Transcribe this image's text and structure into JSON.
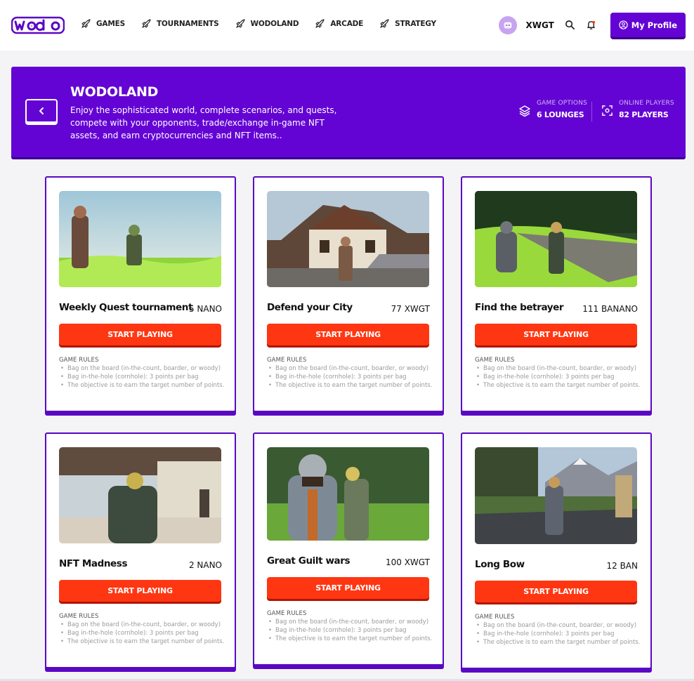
{
  "nav": {
    "logo_text": "wodo",
    "items": [
      {
        "label": "GAMES"
      },
      {
        "label": "TOURNAMENTS"
      },
      {
        "label": "WODOLAND"
      },
      {
        "label": "ARCADE"
      },
      {
        "label": "STRATEGY"
      }
    ],
    "username": "XWGT",
    "profile_label": "My Profile"
  },
  "banner": {
    "title": "WODOLAND",
    "description": "Enjoy the sophisticated world, complete scenarios, and quests, compete with your opponents, trade/exchange in-game NFT assets, and earn cryptocurrencies and NFT items..",
    "stats": [
      {
        "label": "GAME OPTIONS",
        "value": "6 LOUNGES"
      },
      {
        "label": "ONLINE PLAYERS",
        "value": "82 PLAYERS"
      }
    ]
  },
  "rules": {
    "heading": "GAME RULES",
    "items": [
      "Bag on the board (in-the-count, boarder, or woody)",
      "Bag in-the-hole (cornhole): 3 points per bag",
      "The objective is to earn the target number of points."
    ]
  },
  "cards": [
    {
      "title": "Weekly Quest tournament",
      "price": "5 NANO",
      "button": "START PLAYING"
    },
    {
      "title": "Defend your City",
      "price": "77 XWGT",
      "button": "START PLAYING"
    },
    {
      "title": "Find the betrayer",
      "price": "111 BANANO",
      "button": "START PLAYING"
    },
    {
      "title": "NFT Madness",
      "price": "2 NANO",
      "button": "START PLAYING"
    },
    {
      "title": "Great Guilt wars",
      "price": "100 XWGT",
      "button": "START PLAYING"
    },
    {
      "title": "Long Bow",
      "price": "12 BAN",
      "button": "START PLAYING"
    }
  ],
  "colors": {
    "brand_purple": "#6404d4",
    "play_red": "#ff3612"
  }
}
